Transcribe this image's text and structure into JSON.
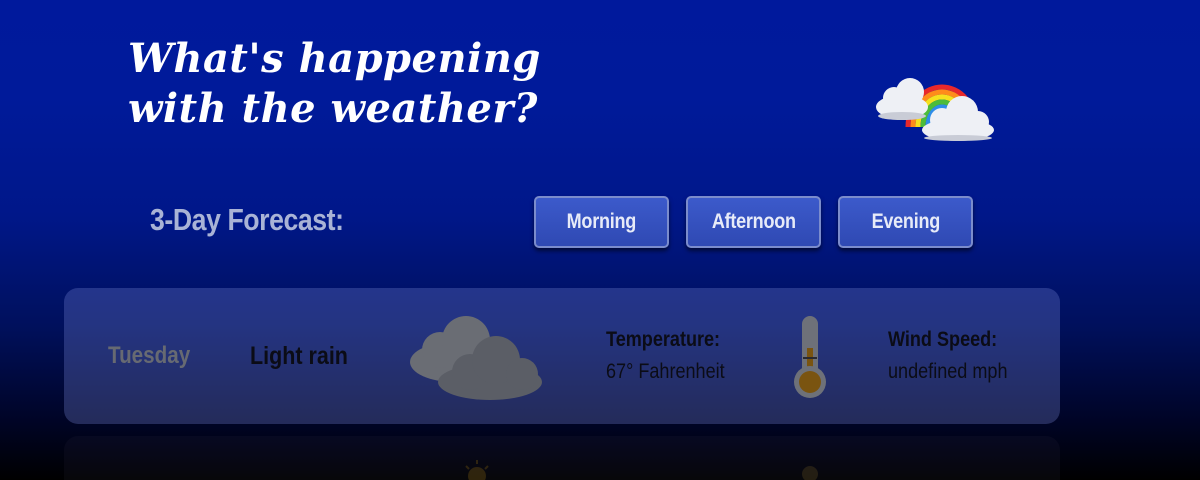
{
  "header": {
    "title_line1": "What's happening",
    "title_line2": "with the weather?",
    "logo_icon": "rainbow-cloud-icon"
  },
  "forecast": {
    "label": "3-Day Forecast:",
    "buttons": [
      {
        "label": "Morning"
      },
      {
        "label": "Afternoon"
      },
      {
        "label": "Evening"
      }
    ]
  },
  "cards": [
    {
      "day": "Tuesday",
      "condition": "Light rain",
      "condition_icon": "cloud-icon",
      "temperature_label": "Temperature:",
      "temperature_value": "67° Fahrenheit",
      "thermometer_icon": "thermometer-icon",
      "wind_label": "Wind Speed:",
      "wind_value": "undefined mph"
    }
  ],
  "colors": {
    "background_top": "#00199c",
    "background_bottom": "#000000",
    "button_fill": "#3551bf",
    "card_fill": "#4e5fb8"
  }
}
